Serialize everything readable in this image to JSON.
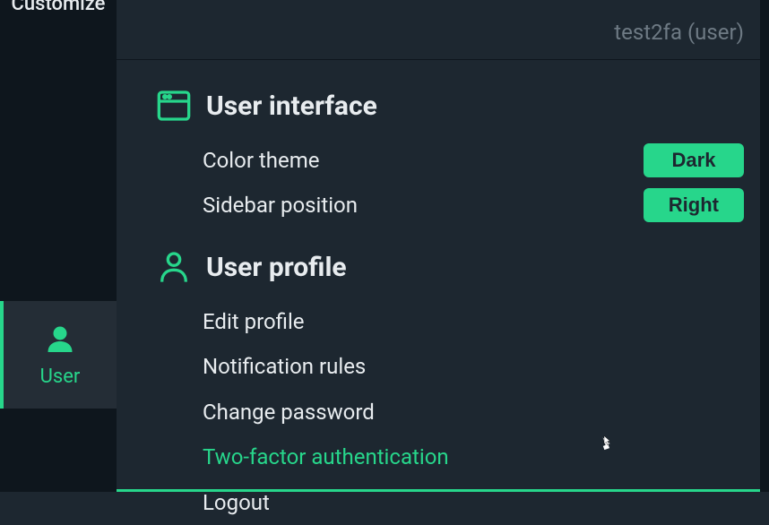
{
  "sidebar": {
    "top_item": "Customize",
    "active_item": "User"
  },
  "header": {
    "user_indicator": "test2fa (user)"
  },
  "sections": {
    "ui": {
      "title": "User interface",
      "color_theme": {
        "label": "Color theme",
        "value": "Dark"
      },
      "sidebar_position": {
        "label": "Sidebar position",
        "value": "Right"
      }
    },
    "profile": {
      "title": "User profile",
      "items": {
        "edit": "Edit profile",
        "notifications": "Notification rules",
        "password": "Change password",
        "twofa": "Two-factor authentication",
        "logout": "Logout"
      }
    }
  }
}
